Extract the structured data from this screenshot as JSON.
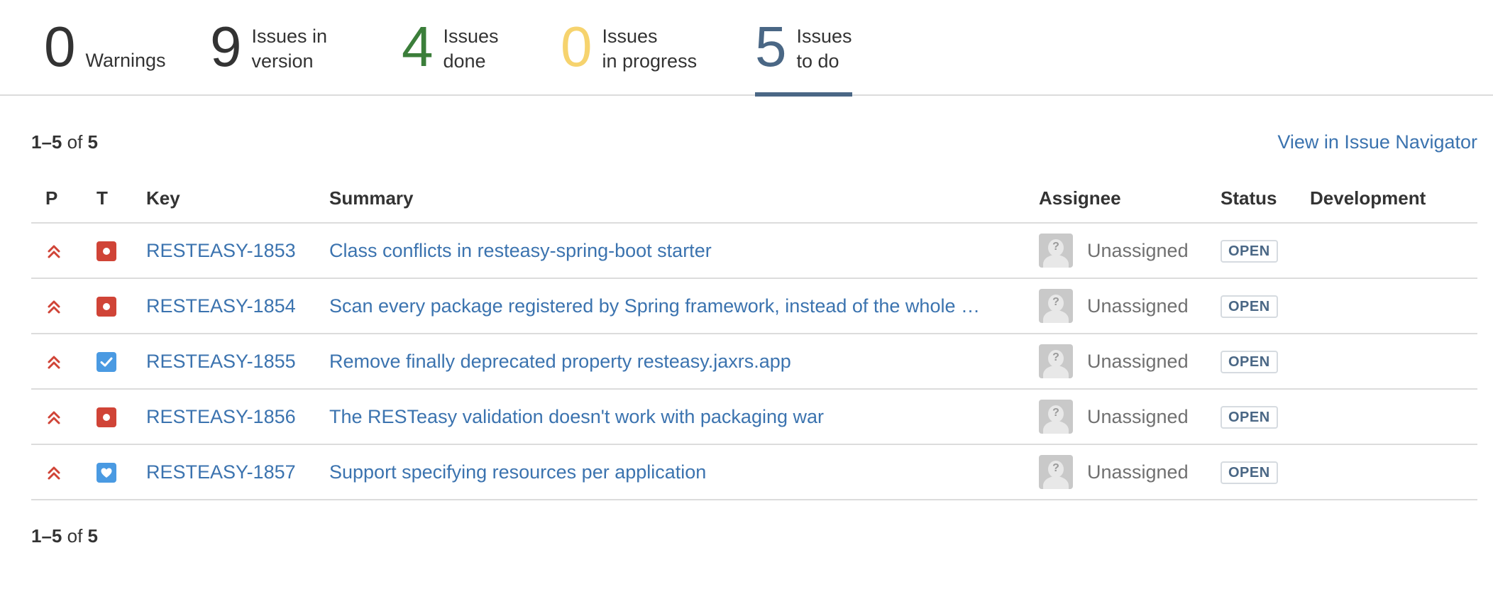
{
  "stats": [
    {
      "count": "0",
      "line1": "Warnings",
      "line2": "",
      "color": "#333333"
    },
    {
      "count": "9",
      "line1": "Issues in",
      "line2": "version",
      "color": "#333333"
    },
    {
      "count": "4",
      "line1": "Issues",
      "line2": "done",
      "color": "#3b7e3a"
    },
    {
      "count": "0",
      "line1": "Issues",
      "line2": "in progress",
      "color": "#f6d36e"
    },
    {
      "count": "5",
      "line1": "Issues",
      "line2": "to do",
      "color": "#4a6785"
    }
  ],
  "pager": {
    "range": "1–5",
    "of": "of",
    "total": "5"
  },
  "navigator_link": "View in Issue Navigator",
  "columns": {
    "priority": "P",
    "type": "T",
    "key": "Key",
    "summary": "Summary",
    "assignee": "Assignee",
    "status": "Status",
    "development": "Development"
  },
  "issues": [
    {
      "priority_icon": "highest-priority-icon",
      "type": "bug",
      "type_icon": "bug-icon",
      "key": "RESTEASY-1853",
      "summary": "Class conflicts in resteasy-spring-boot starter",
      "assignee": "Unassigned",
      "status": "OPEN",
      "development": ""
    },
    {
      "priority_icon": "highest-priority-icon",
      "type": "bug",
      "type_icon": "bug-icon",
      "key": "RESTEASY-1854",
      "summary": "Scan every package registered by Spring framework, instead of the whole …",
      "assignee": "Unassigned",
      "status": "OPEN",
      "development": ""
    },
    {
      "priority_icon": "highest-priority-icon",
      "type": "task",
      "type_icon": "task-checkbox-icon",
      "key": "RESTEASY-1855",
      "summary": "Remove finally deprecated property resteasy.jaxrs.app",
      "assignee": "Unassigned",
      "status": "OPEN",
      "development": ""
    },
    {
      "priority_icon": "highest-priority-icon",
      "type": "bug",
      "type_icon": "bug-icon",
      "key": "RESTEASY-1856",
      "summary": "The RESTeasy validation doesn't work with packaging war",
      "assignee": "Unassigned",
      "status": "OPEN",
      "development": ""
    },
    {
      "priority_icon": "highest-priority-icon",
      "type": "feature",
      "type_icon": "feature-heart-icon",
      "key": "RESTEASY-1857",
      "summary": "Support specifying resources per application",
      "assignee": "Unassigned",
      "status": "OPEN",
      "development": ""
    }
  ],
  "colors": {
    "link": "#3b73af",
    "priority": "#d04437",
    "bug": "#d04437",
    "task": "#4a9ae2",
    "active_tab": "#4a6785"
  }
}
